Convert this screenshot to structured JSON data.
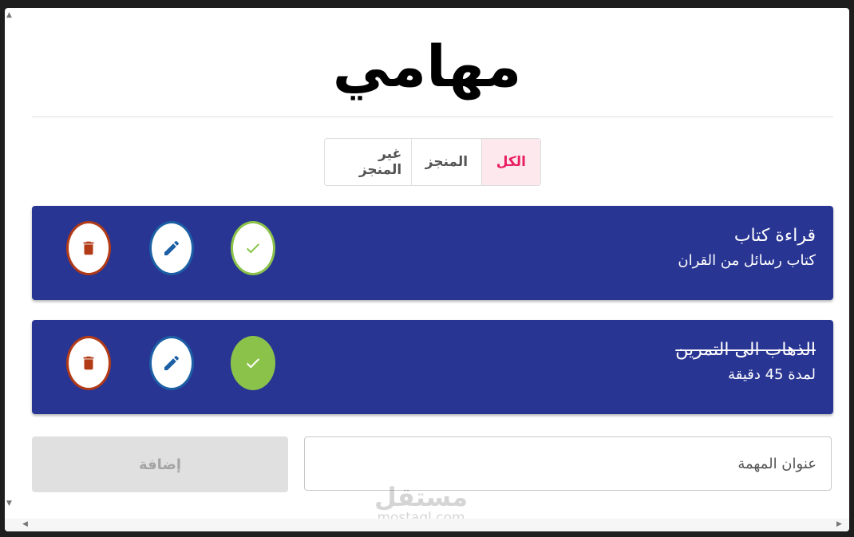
{
  "app": {
    "title": "مهامي"
  },
  "filters": [
    {
      "label": "الكل",
      "active": true
    },
    {
      "label": "المنجز",
      "active": false
    },
    {
      "label": "غير المنجز",
      "active": false
    }
  ],
  "tasks": [
    {
      "title": "قراءة كتاب",
      "description": "كتاب رسائل من القران",
      "completed": false
    },
    {
      "title": "الذهاب الى التمرين",
      "description": "لمدة 45 دقيقة",
      "completed": true
    }
  ],
  "form": {
    "placeholder": "عنوان المهمة",
    "add_label": "إضافة"
  },
  "watermark": {
    "arabic": "مستقل",
    "latin": "mostaql.com"
  },
  "colors": {
    "card": "#293593",
    "active_filter": "#e91e63",
    "check": "#8bc34a",
    "edit": "#1c5fa5",
    "delete": "#b23a16"
  }
}
